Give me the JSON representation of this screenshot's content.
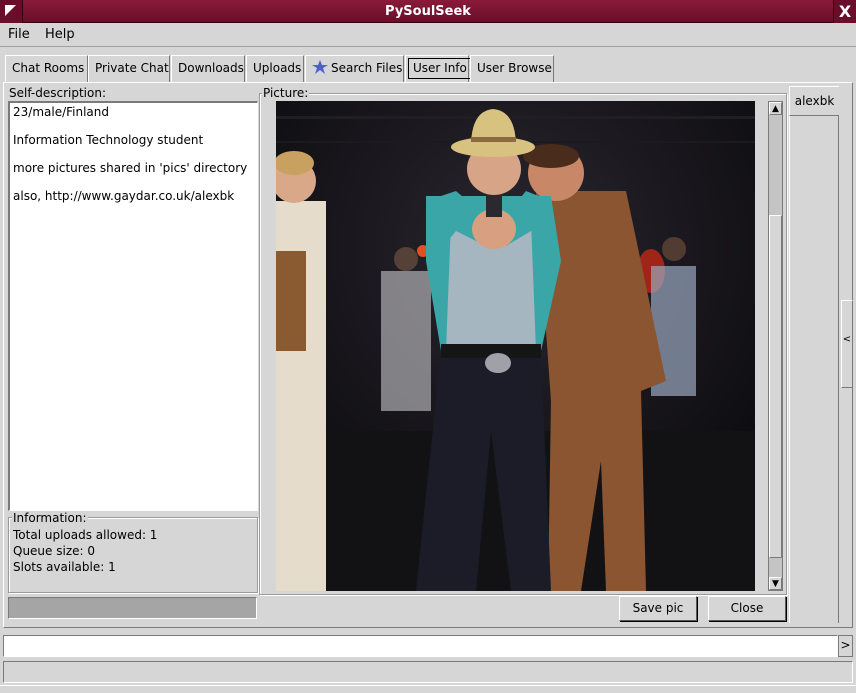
{
  "window": {
    "title": "PySoulSeek",
    "close_glyph": "X"
  },
  "menu": {
    "items": [
      {
        "label": "File"
      },
      {
        "label": "Help"
      }
    ]
  },
  "tabs": [
    {
      "label": "Chat Rooms"
    },
    {
      "label": "Private Chat"
    },
    {
      "label": "Downloads"
    },
    {
      "label": "Uploads"
    },
    {
      "label": "Search Files",
      "icon": "star-icon"
    },
    {
      "label": "User Info",
      "active": true
    },
    {
      "label": "User Browse"
    }
  ],
  "user_info": {
    "self_description_label": "Self-description:",
    "self_description_lines": [
      "23/male/Finland",
      "Information Technology student",
      "more pictures shared in 'pics' directory",
      "also, http://www.gaydar.co.uk/alexbk"
    ],
    "information_label": "Information:",
    "information_lines": [
      "Total uploads allowed: 1",
      "Queue size: 0",
      "Slots available: 1"
    ],
    "picture_label": "Picture:",
    "buttons": {
      "save_pic": "Save pic",
      "close": "Close"
    },
    "user_tab": "alexbk"
  },
  "colors": {
    "titlebar": "#7a1232",
    "background": "#d6d6d6",
    "progress": "#a5a5a5"
  },
  "misc": {
    "pane_handle_glyph": "<",
    "scroll_up_glyph": "▲",
    "scroll_down_glyph": "▼",
    "log_scroll_glyph": ">"
  }
}
